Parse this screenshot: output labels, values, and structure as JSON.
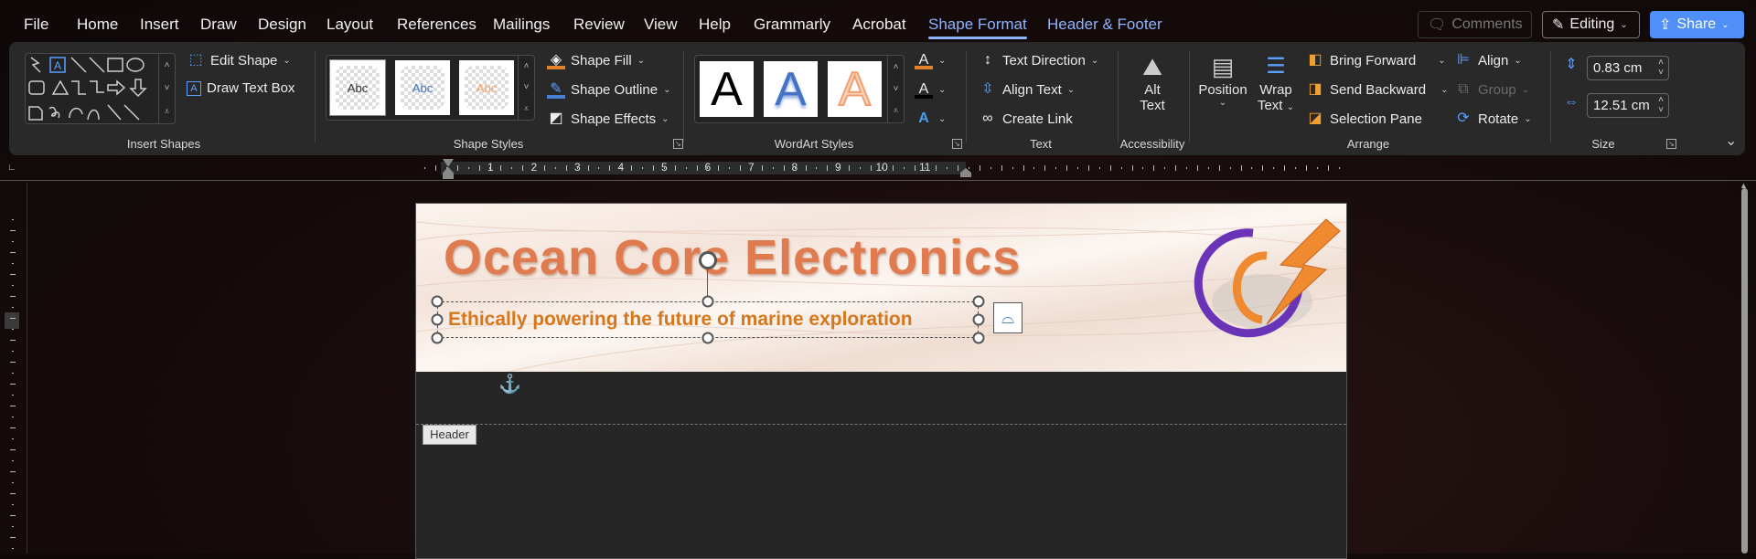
{
  "tabs": [
    "File",
    "Home",
    "Insert",
    "Draw",
    "Design",
    "Layout",
    "References",
    "Mailings",
    "Review",
    "View",
    "Help",
    "Grammarly",
    "Acrobat",
    "Shape Format",
    "Header & Footer"
  ],
  "top_buttons": {
    "comments": "Comments",
    "editing": "Editing",
    "share": "Share"
  },
  "ribbon": {
    "insert_shapes": {
      "edit_shape": "Edit Shape",
      "draw_text_box": "Draw Text Box",
      "label": "Insert Shapes"
    },
    "shape_styles": {
      "thumbs": [
        "Abc",
        "Abc",
        "Abc"
      ],
      "shape_fill": "Shape Fill",
      "shape_outline": "Shape Outline",
      "shape_effects": "Shape Effects",
      "label": "Shape Styles"
    },
    "wordart_styles": {
      "tiles": [
        "A",
        "A",
        "A"
      ],
      "label": "WordArt Styles"
    },
    "text": {
      "text_direction": "Text Direction",
      "align_text": "Align Text",
      "create_link": "Create Link",
      "label": "Text"
    },
    "accessibility": {
      "alt": "Alt",
      "text": "Text",
      "label": "Accessibility"
    },
    "arrange": {
      "position": "Position",
      "wrap": "Wrap",
      "wrap_text": "Text",
      "bring_forward": "Bring Forward",
      "send_backward": "Send Backward",
      "selection_pane": "Selection Pane",
      "align": "Align",
      "group": "Group",
      "rotate": "Rotate",
      "label": "Arrange"
    },
    "size": {
      "height": "0.83 cm",
      "width": "12.51 cm",
      "label": "Size"
    }
  },
  "ruler": {
    "numbers": [
      "1",
      "2",
      "3",
      "4",
      "5",
      "6",
      "7",
      "8",
      "9",
      "10",
      "11"
    ]
  },
  "document": {
    "title": "Ocean Core Electronics",
    "tagline": "Ethically powering the future of marine exploration",
    "header_tag": "Header"
  },
  "colors": {
    "accent": "#8fb4ff",
    "share": "#4f8ff7",
    "title": "#e07a4f",
    "tagline": "#d7771c",
    "logo_purple": "#6a34b8",
    "logo_orange": "#f08a30"
  }
}
